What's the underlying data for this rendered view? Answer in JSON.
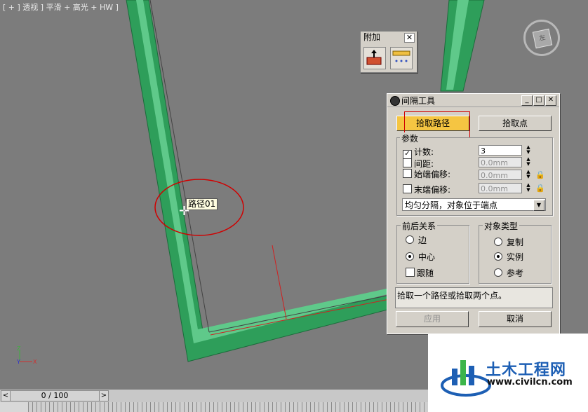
{
  "viewport": {
    "label": "[ + ] 透视 ] 平滑 + 高光 + HW ]",
    "path_label": "路径01",
    "viewcube_face": "左"
  },
  "attach_toolbar": {
    "title": "附加",
    "close": "✕"
  },
  "spacing_dialog": {
    "title": "间隔工具",
    "pick_path_button": "拾取路径",
    "pick_points_button": "拾取点",
    "params_group": "参数",
    "count_label": "计数:",
    "count_value": "3",
    "spacing_label": "间距:",
    "spacing_value": "0.0mm",
    "start_offset_label": "始端偏移:",
    "start_offset_value": "0.0mm",
    "end_offset_label": "末端偏移:",
    "end_offset_value": "0.0mm",
    "distribution_value": "均匀分隔，对象位于端点",
    "context_group": "前后关系",
    "context_options": [
      "边",
      "中心",
      "跟随"
    ],
    "object_type_group": "对象类型",
    "object_type_options": [
      "复制",
      "实例",
      "参考"
    ],
    "status_text": "拾取一个路径或拾取两个点。",
    "apply_button": "应用",
    "cancel_button": "取消"
  },
  "timeline": {
    "frame_readout": "0 / 100",
    "prev": "<",
    "next": ">"
  },
  "watermark": {
    "name": "土木工程网",
    "url": "www.civilcn.com"
  },
  "colors": {
    "frame_green": "#2e9e5a",
    "highlight_button": "#f5c542",
    "annotation_red": "#d00000"
  }
}
